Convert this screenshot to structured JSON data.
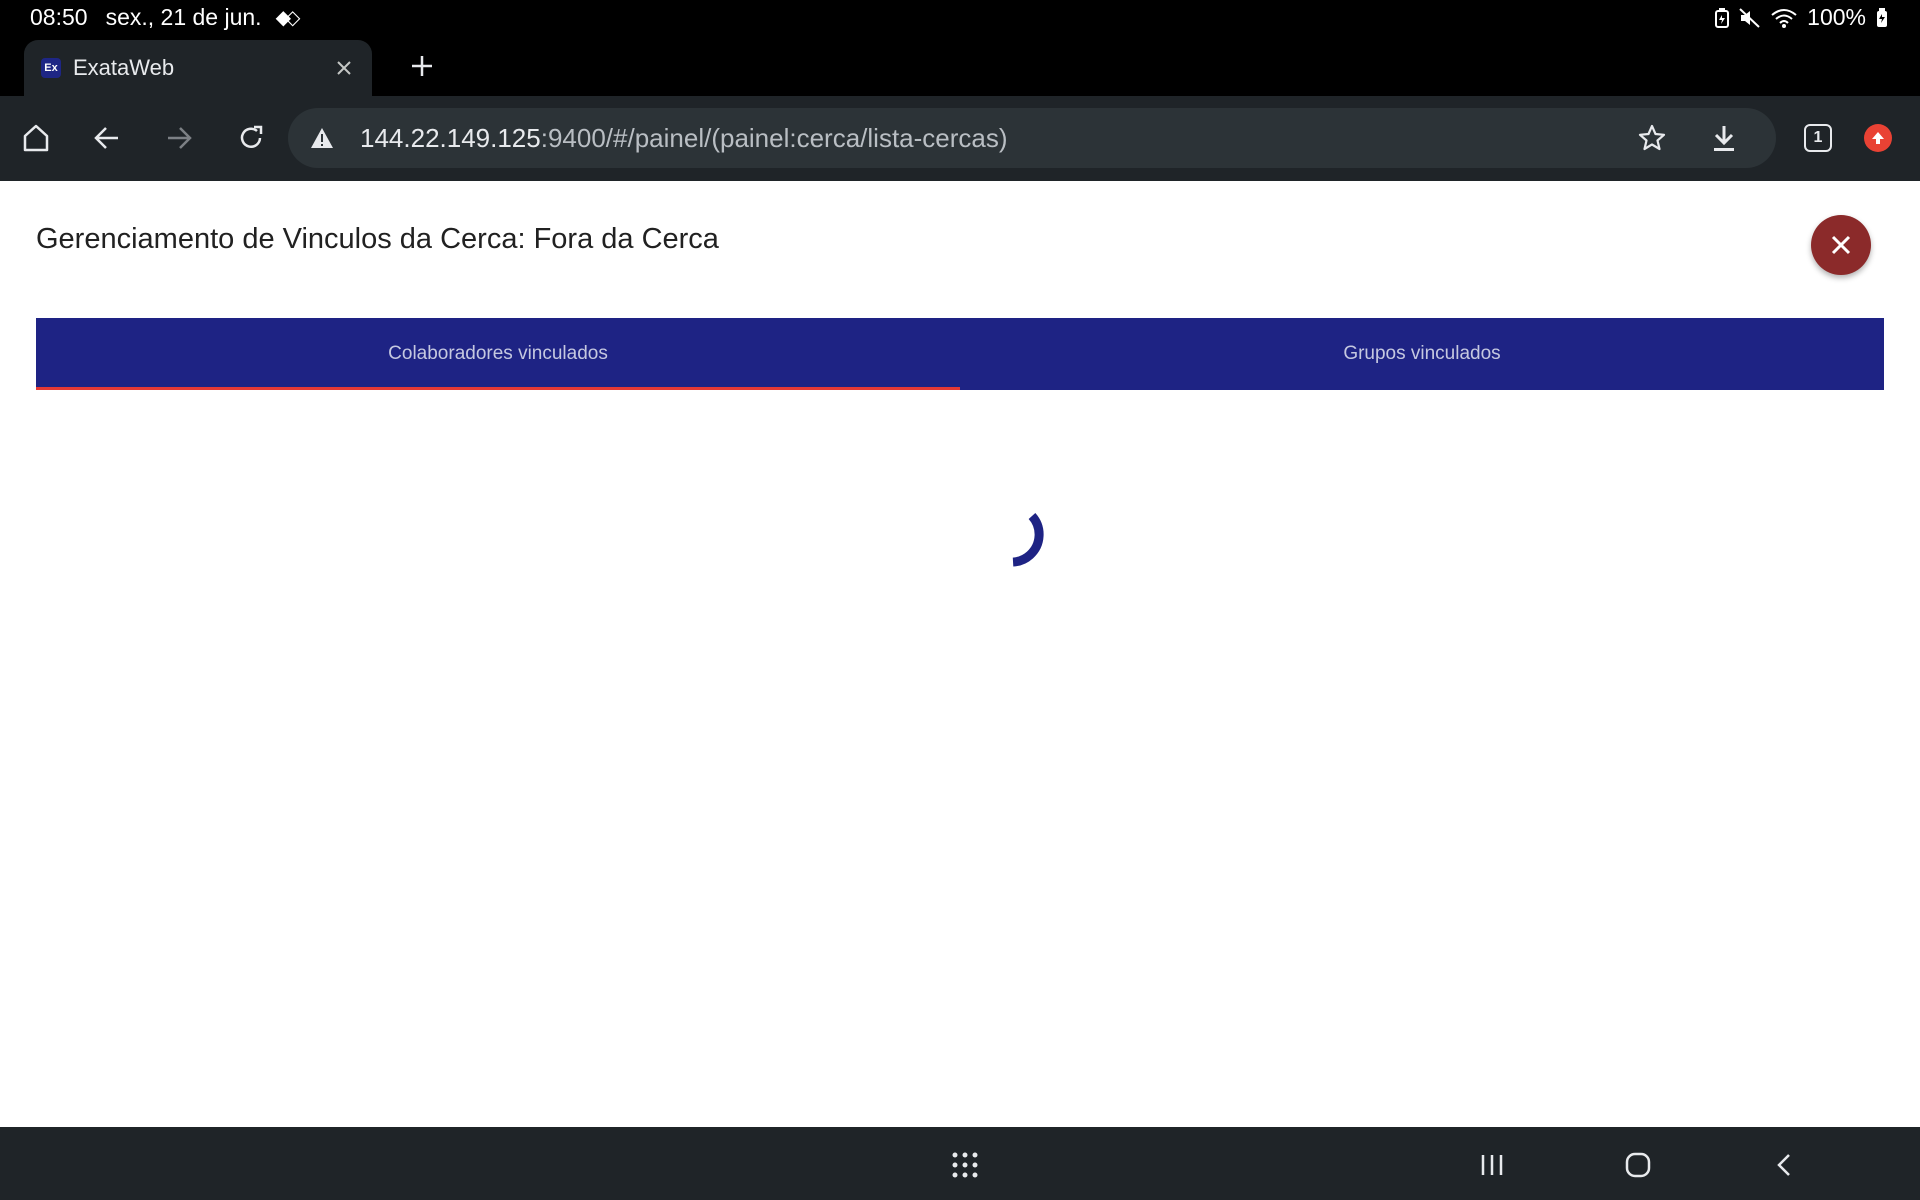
{
  "status_bar": {
    "time": "08:50",
    "date": "sex., 21 de jun.",
    "battery": "100%"
  },
  "browser": {
    "tab_title": "ExataWeb",
    "favicon_text": "Ex",
    "url_host": "144.22.149.125",
    "url_rest": ":9400/#/painel/(painel:cerca/lista-cercas)",
    "tab_count": "1"
  },
  "dialog": {
    "title": "Gerenciamento de Vinculos da Cerca: Fora da Cerca",
    "tabs": [
      {
        "label": "Colaboradores vinculados",
        "active": true
      },
      {
        "label": "Grupos vinculados",
        "active": false
      }
    ]
  },
  "colors": {
    "tab_bar": "#1e2384",
    "active_indicator": "#e53935",
    "close_button": "#8b2a2a",
    "spinner": "#1e2384"
  }
}
